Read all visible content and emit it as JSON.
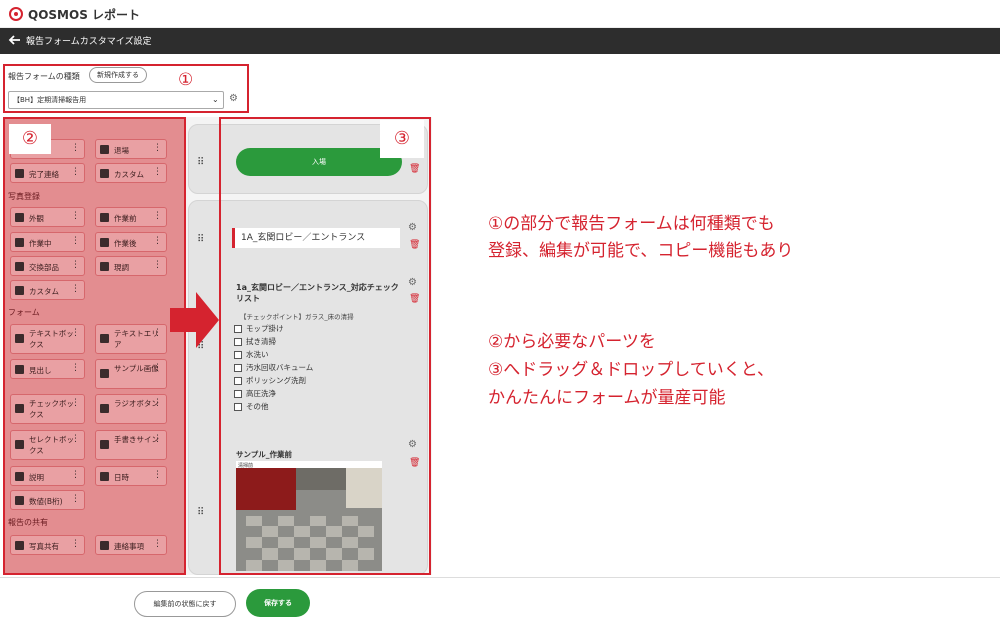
{
  "app": {
    "logo_text": "QOSMOS レポート"
  },
  "nav": {
    "title": "報告フォームカスタマイズ設定"
  },
  "selector": {
    "type_label": "報告フォームの種類",
    "new_button": "新規作成する",
    "selected": "【BH】定期清掃報告用",
    "number_label": "①"
  },
  "palette": {
    "number_label": "②",
    "items_top": [
      {
        "label": "退場",
        "icon": "exit-icon"
      },
      {
        "label": "完了連絡",
        "icon": "document-icon"
      },
      {
        "label": "カスタム",
        "icon": "custom-icon"
      }
    ],
    "section_photo": "写真登録",
    "photo_items": [
      {
        "label": "外観",
        "icon": "building-icon"
      },
      {
        "label": "作業前",
        "icon": "briefcase-icon"
      },
      {
        "label": "作業中",
        "icon": "group-icon"
      },
      {
        "label": "作業後",
        "icon": "sitemap-icon"
      },
      {
        "label": "交換部品",
        "icon": "exchange-icon"
      },
      {
        "label": "現調",
        "icon": "clipboard-icon"
      },
      {
        "label": "カスタム",
        "icon": "image-icon"
      }
    ],
    "section_form": "フォーム",
    "form_items": [
      {
        "label": "テキストボックス",
        "icon": "edit-icon"
      },
      {
        "label": "テキストエリア",
        "icon": "file-text-icon"
      },
      {
        "label": "見出し",
        "icon": "info-icon"
      },
      {
        "label": "サンプル画像",
        "icon": "picture-icon"
      },
      {
        "label": "チェックボックス",
        "icon": "checkbox-icon"
      },
      {
        "label": "ラジオボタン",
        "icon": "radio-icon"
      },
      {
        "label": "セレクトボックス",
        "icon": "list-icon"
      },
      {
        "label": "手書きサイン",
        "icon": "hand-icon"
      },
      {
        "label": "説明",
        "icon": "pencil-icon"
      },
      {
        "label": "日時",
        "icon": "clock-icon"
      },
      {
        "label": "数値(B桁)",
        "icon": "calculator-icon"
      }
    ],
    "section_share": "報告の共有",
    "share_items": [
      {
        "label": "写真共有",
        "icon": "photos-icon"
      },
      {
        "label": "連絡事項",
        "icon": "comment-icon"
      }
    ]
  },
  "form": {
    "number_label": "③",
    "enter_button": "入場",
    "heading": "1A_玄関ロビー／エントランス",
    "checklist_title": "1a_玄関ロビー／エントランス_対応チェックリスト",
    "checkpoint": "【チェックポイント】ガラス_床の清掃",
    "checklist_items": [
      "モップ掛け",
      "拭き清掃",
      "水洗い",
      "汚水回収バキューム",
      "ポリッシング洗剤",
      "高圧洗浄",
      "その他"
    ],
    "sample_title": "サンプル_作業前",
    "sample_caption": "清掃前"
  },
  "annotations": {
    "line1": "①の部分で報告フォームは何種類でも",
    "line2": "登録、編集が可能で、コピー機能もあり",
    "line3": "②から必要なパーツを",
    "line4": "③へドラッグ＆ドロップしていくと、",
    "line5": "かんたんにフォームが量産可能"
  },
  "footer": {
    "revert_button": "編集前の状態に戻す",
    "save_button": "保存する"
  },
  "colors": {
    "accent_red": "#d5232f",
    "green": "#2b9a3c",
    "dark_bar": "#2d2d2d",
    "palette_pink": "#e38d90"
  }
}
